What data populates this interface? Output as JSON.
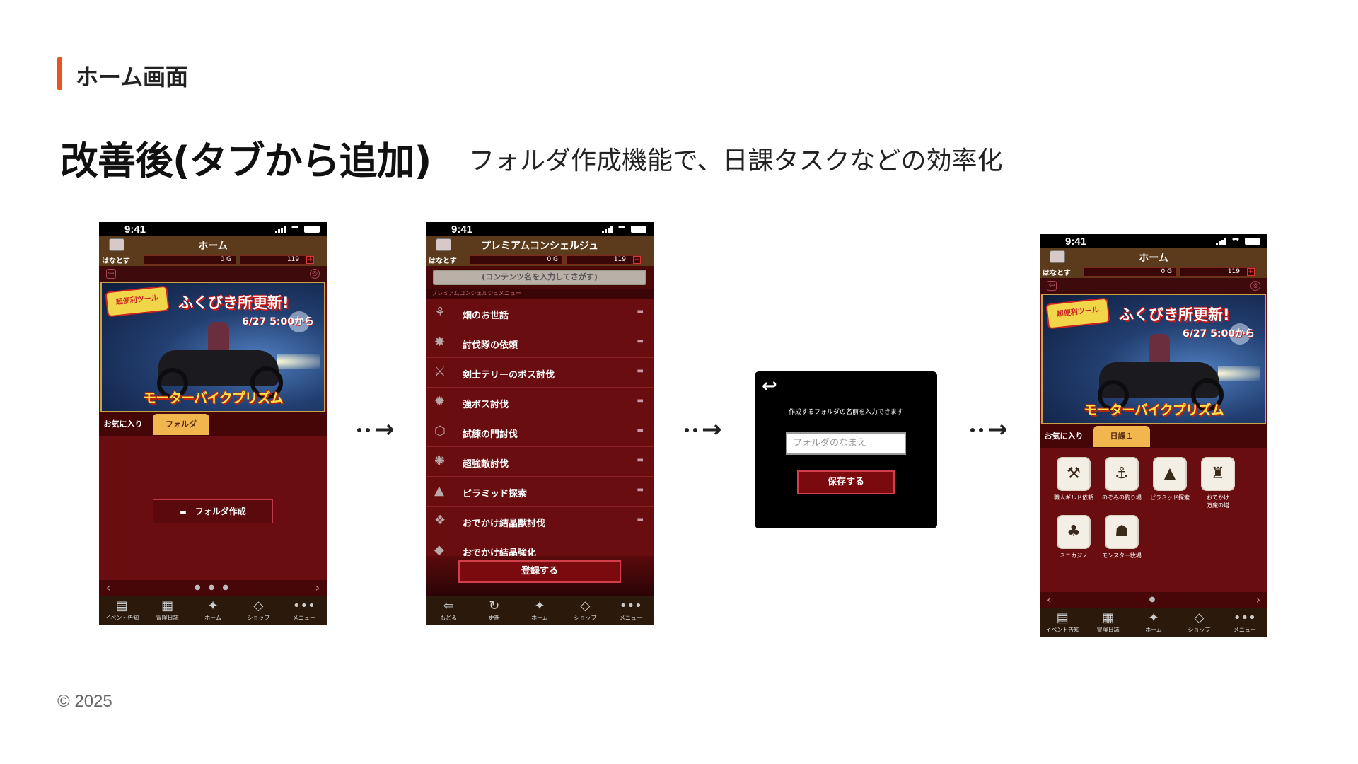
{
  "section_title": "ホーム画面",
  "main_title": "改善後(タブから追加)",
  "subtitle": "フォルダ作成機能で、日課タスクなどの効率化",
  "copyright": "© 2025",
  "status_time": "9:41",
  "user_label": "はなとす",
  "gold": "0 G",
  "coins": "119",
  "coin_plus": "+",
  "banner": {
    "logo": "超便利ツール",
    "title": "ふくびき所更新!",
    "date": "6/27 5:00から",
    "name": "モーターバイクプリズム"
  },
  "screen1": {
    "title": "ホーム",
    "tab_favorites": "お気に入り",
    "tab_folder": "フォルダ",
    "folder_create_button": "フォルダ作成",
    "folder_icon": "folder-icon"
  },
  "screen2": {
    "title": "プレミアムコンシェルジュ",
    "search_placeholder": "(コンテンツ名を入力してさがす)",
    "menu_label": "プレミアムコンシェルジュメニュー",
    "items": [
      {
        "label": "畑のお世話"
      },
      {
        "label": "討伐隊の依頼"
      },
      {
        "label": "剣士テリーのボス討伐"
      },
      {
        "label": "強ボス討伐"
      },
      {
        "label": "試練の門討伐"
      },
      {
        "label": "超強敵討伐"
      },
      {
        "label": "ピラミッド探索"
      },
      {
        "label": "おでかけ結晶獣討伐"
      },
      {
        "label": "おでかけ結晶強化"
      }
    ],
    "register_button": "登録する"
  },
  "dialog": {
    "prompt": "作成するフォルダの名前を入力できます",
    "placeholder": "フォルダのなまえ",
    "save_button": "保存する"
  },
  "screen4": {
    "title": "ホーム",
    "tab_favorites": "お気に入り",
    "tab_active": "日課１",
    "grid": [
      {
        "label": "職人ギルド依頼",
        "icon": "guild-icon"
      },
      {
        "label": "のぞみの釣り場",
        "icon": "fishing-icon"
      },
      {
        "label": "ピラミッド探索",
        "icon": "pyramid-icon"
      },
      {
        "label": "おでかけ\n万魔の塔",
        "icon": "tower-icon"
      },
      {
        "label": "ミニカジノ",
        "icon": "casino-icon"
      },
      {
        "label": "モンスター牧場",
        "icon": "monster-ranch-icon"
      }
    ]
  },
  "tabbar_home": [
    {
      "label": "イベント告知",
      "icon": "event-icon"
    },
    {
      "label": "冒険日誌",
      "icon": "diary-icon"
    },
    {
      "label": "ホーム",
      "icon": "home-icon"
    },
    {
      "label": "ショップ",
      "icon": "shop-icon"
    },
    {
      "label": "メニュー",
      "icon": "menu-icon"
    }
  ],
  "tabbar_concierge": [
    {
      "label": "もどる",
      "icon": "back-icon"
    },
    {
      "label": "更新",
      "icon": "refresh-icon"
    },
    {
      "label": "ホーム",
      "icon": "home-icon"
    },
    {
      "label": "ショップ",
      "icon": "shop-icon"
    },
    {
      "label": "メニュー",
      "icon": "menu-icon"
    }
  ]
}
